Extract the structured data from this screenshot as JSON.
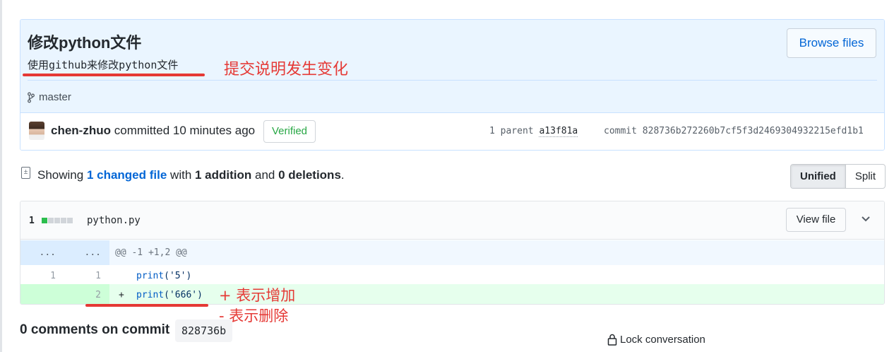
{
  "commit": {
    "title": "修改python文件",
    "description": "使用github来修改python文件",
    "browse_label": "Browse files",
    "branch": "master",
    "author": "chen-zhuo",
    "action": "committed",
    "time": "10 minutes ago",
    "verified_label": "Verified",
    "parent_label": "1 parent",
    "parent_sha": "a13f81a",
    "commit_label": "commit",
    "commit_sha": "828736b272260b7cf5f3d2469304932215efd1b1"
  },
  "annotations": {
    "desc_note": "提交说明发生变化",
    "add_note": "+ 表示增加",
    "del_note": "- 表示删除"
  },
  "toolbar": {
    "showing_prefix": "Showing ",
    "changed_files": "1 changed file",
    "with": " with ",
    "additions": "1 addition",
    "and": " and ",
    "deletions": "0 deletions",
    "period": ".",
    "unified_label": "Unified",
    "split_label": "Split",
    "view_mode": "Unified"
  },
  "file": {
    "change_count": "1",
    "name": "python.py",
    "view_file_label": "View file",
    "diffstat": [
      "add",
      "neutral",
      "neutral",
      "neutral",
      "neutral"
    ],
    "hunk": {
      "left": "...",
      "right": "...",
      "header": "@@ -1 +1,2 @@"
    },
    "lines": [
      {
        "old": "1",
        "new": "1",
        "sign": "",
        "fn": "print",
        "arg": "('5')"
      },
      {
        "old": "",
        "new": "2",
        "sign": "+",
        "fn": "print",
        "arg": "('666')"
      }
    ]
  },
  "footer": {
    "comments_label": "0 comments on commit",
    "sha_short": "828736b",
    "lock_label": "Lock conversation"
  },
  "colors": {
    "annotation_red": "#e53935",
    "link_blue": "#0366d6",
    "verified_green": "#28a745",
    "addition_bg": "#e6ffed"
  }
}
